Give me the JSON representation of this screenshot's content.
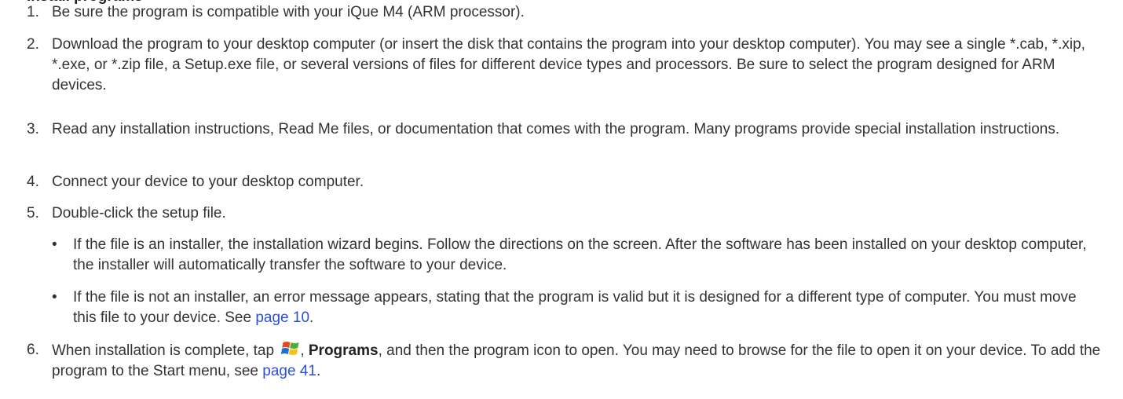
{
  "heading": "Install programs",
  "steps": [
    {
      "num": "1.",
      "text": "Be sure the program is compatible with your iQue M4 (ARM processor)."
    },
    {
      "num": "2.",
      "text": "Download the program to your desktop computer (or insert the disk that contains the program into your desktop computer). You may see a single *.cab, *.xip, *.exe, or *.zip file, a Setup.exe file, or several versions of files for different device types and processors. Be sure to select the program designed for ARM devices."
    },
    {
      "num": "3.",
      "text": "Read any installation instructions, Read Me files, or documentation that comes with the program. Many programs provide special installation instructions."
    },
    {
      "num": "4.",
      "text": "Connect your device to your desktop computer."
    },
    {
      "num": "5.",
      "text": "Double-click the setup file."
    },
    {
      "num": "6.",
      "text_a": "When installation is complete, tap ",
      "text_b": ", ",
      "strong": "Programs",
      "text_c": ", and then the program icon to open. You may need to browse for the file to open it on your device. To add the program to the Start menu, see ",
      "link": "page 41",
      "text_d": "."
    }
  ],
  "bullets": [
    {
      "dot": "•",
      "text": "If the file is an installer, the installation wizard begins. Follow the directions on the screen. After the software has been installed on your desktop computer, the installer will automatically transfer the software to your device."
    },
    {
      "dot": "•",
      "text": "If the file is not an installer, an error message appears, stating that the program is valid but it is designed for a different type of computer. You must move this file to your device. See ",
      "link": "page 10",
      "tail": "."
    }
  ],
  "start_icon": "windows-start-flag-icon",
  "colors": {
    "text": "#333333",
    "link": "#2b4fd6"
  }
}
